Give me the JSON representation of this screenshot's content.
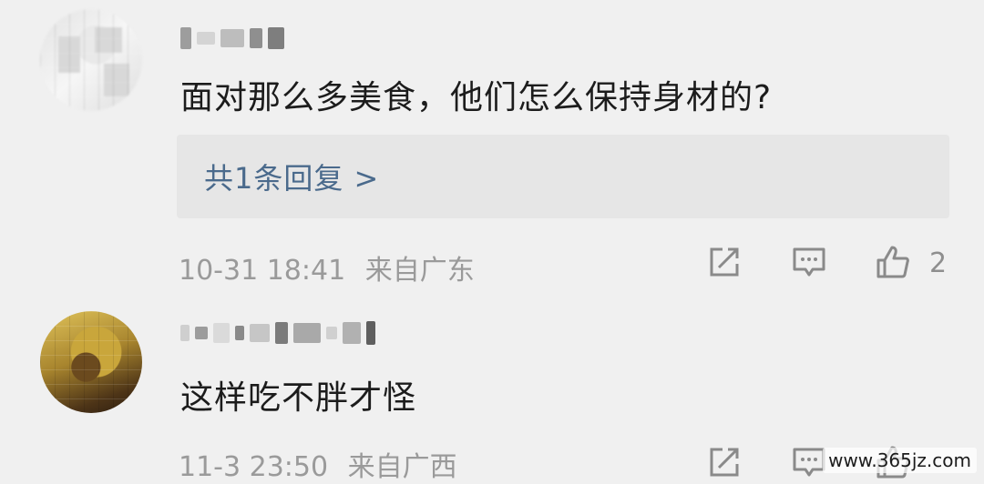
{
  "comments": [
    {
      "text": "面对那么多美食，他们怎么保持身材的?",
      "reply_link": "共1条回复 >",
      "time": "10-31 18:41",
      "location": "来自广东",
      "like_count": "2"
    },
    {
      "text": "这样吃不胖才怪",
      "time": "11-3 23:50",
      "location": "来自广西"
    }
  ],
  "watermark": "www.365jz.com",
  "icons": {
    "share": "share-icon",
    "comment": "comment-icon",
    "like": "thumbs-up-icon"
  },
  "colors": {
    "background": "#f0f0f0",
    "reply_box": "#e6e6e6",
    "link": "#4a6a8c",
    "meta": "#9a9a9a"
  }
}
